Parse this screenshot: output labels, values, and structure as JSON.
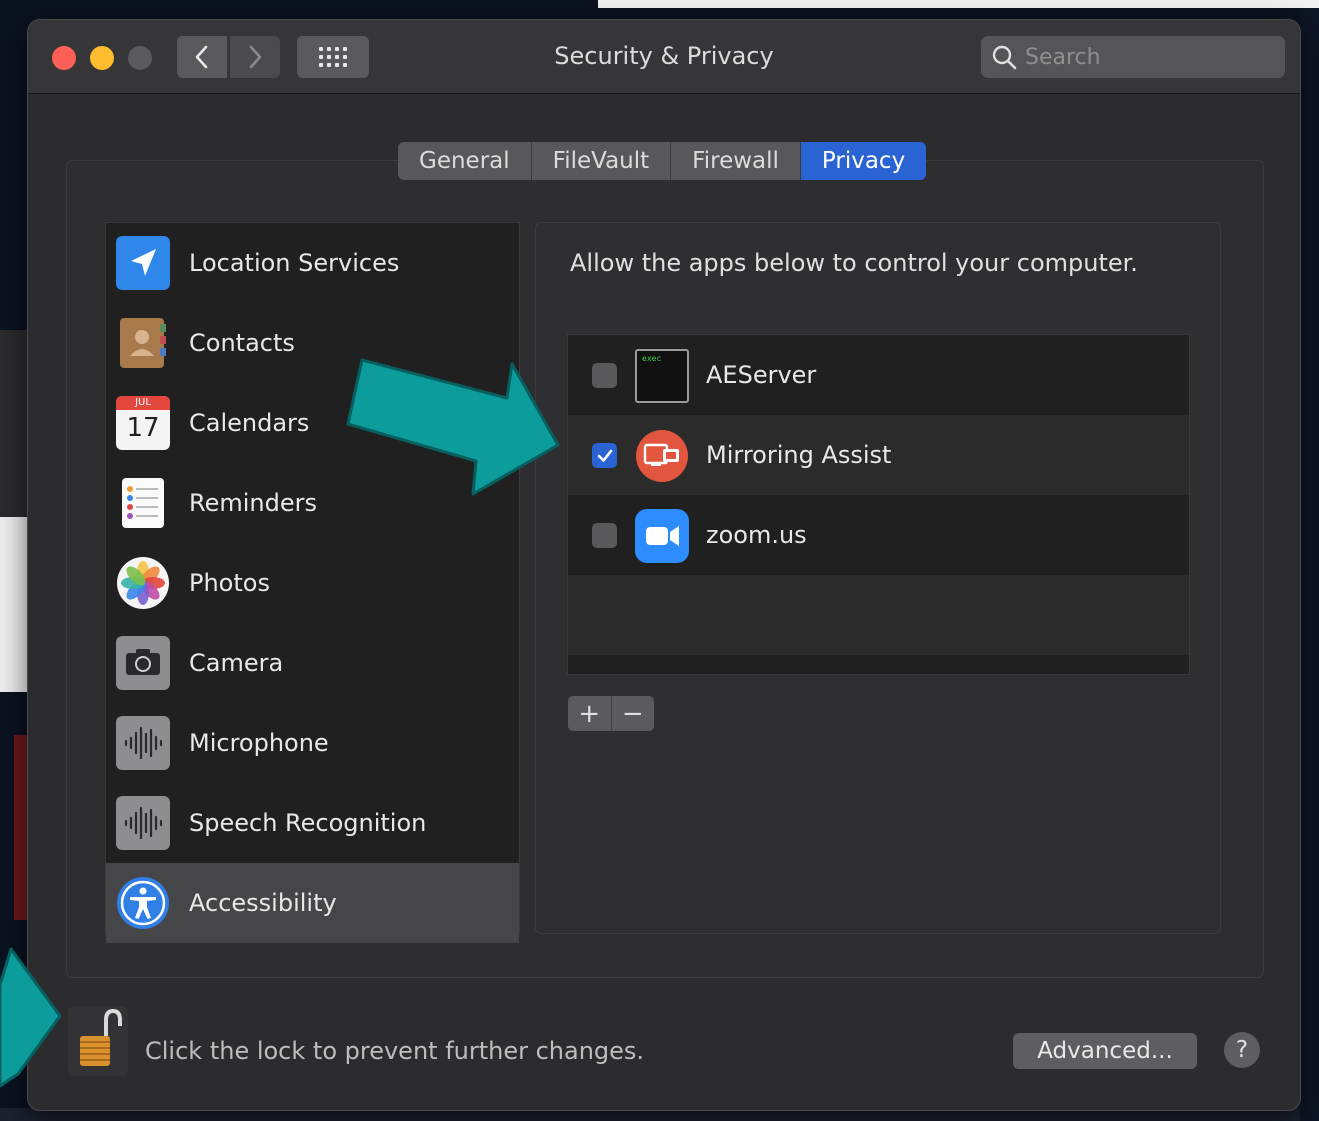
{
  "window": {
    "title": "Security & Privacy"
  },
  "search": {
    "placeholder": "Search"
  },
  "tabs": [
    {
      "label": "General"
    },
    {
      "label": "FileVault"
    },
    {
      "label": "Firewall"
    },
    {
      "label": "Privacy",
      "active": true
    }
  ],
  "sidebar": {
    "items": [
      {
        "label": "Location Services",
        "icon": "location-arrow-icon"
      },
      {
        "label": "Contacts",
        "icon": "contacts-book-icon"
      },
      {
        "label": "Calendars",
        "icon": "calendar-icon",
        "icon_month": "JUL",
        "icon_day": "17"
      },
      {
        "label": "Reminders",
        "icon": "reminders-icon"
      },
      {
        "label": "Photos",
        "icon": "photos-flower-icon"
      },
      {
        "label": "Camera",
        "icon": "camera-icon"
      },
      {
        "label": "Microphone",
        "icon": "microphone-waveform-icon"
      },
      {
        "label": "Speech Recognition",
        "icon": "speech-waveform-icon"
      },
      {
        "label": "Accessibility",
        "icon": "accessibility-icon",
        "selected": true
      }
    ]
  },
  "privacy_panel": {
    "description": "Allow the apps below to control your computer.",
    "apps": [
      {
        "name": "AEServer",
        "checked": false,
        "icon": "terminal-exec-icon",
        "icon_text": "exec"
      },
      {
        "name": "Mirroring Assist",
        "checked": true,
        "icon": "mirroring-assist-icon"
      },
      {
        "name": "zoom.us",
        "checked": false,
        "icon": "zoom-camera-icon"
      }
    ],
    "add_label": "+",
    "remove_label": "−"
  },
  "footer": {
    "lock_text": "Click the lock to prevent further changes.",
    "advanced_label": "Advanced...",
    "help_label": "?"
  },
  "colors": {
    "accent": "#2a63d3",
    "annotation_arrow": "#0c9c9c",
    "window_bg": "#2c2c2e"
  }
}
